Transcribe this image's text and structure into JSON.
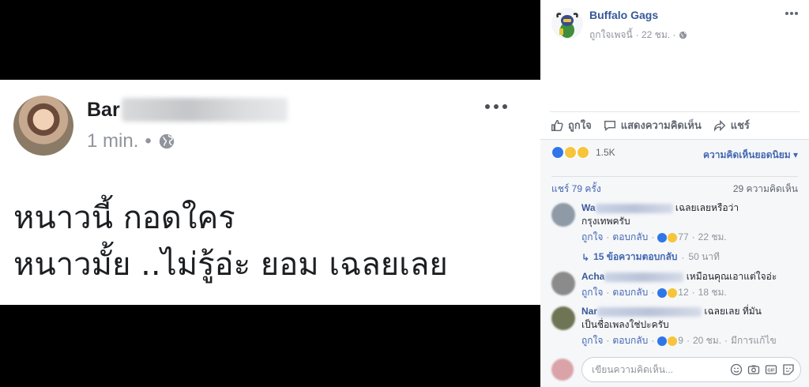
{
  "post_image": {
    "author_name": "Bar",
    "time": "1 min.",
    "bullet": "•",
    "text_line_1": "หนาวนี้ กอดใคร",
    "text_line_2": "หนาวมั้ย ..ไม่รู้อ่ะ ยอม เฉลยเลย"
  },
  "page": {
    "name": "Buffalo Gags",
    "liked_label": "ถูกใจเพจนี้",
    "time": "· 22 ชม. ·"
  },
  "actions": {
    "like": "ถูกใจ",
    "comment": "แสดงความคิดเห็น",
    "share": "แชร์"
  },
  "feedback": {
    "reaction_count": "1.5K",
    "sort_label": "ความคิดเห็นยอดนิยม ▾",
    "shares": "แชร์ 79 ครั้ง",
    "comments_count": "29 ความคิดเห็น"
  },
  "comments": [
    {
      "name": "Wa",
      "text_end": "เฉลยเลยหรือว่า",
      "text_line_2": "กรุงเทพครับ",
      "like": "ถูกใจ",
      "reply": "ตอบกลับ",
      "reacts": "77",
      "time": "22 ชม."
    },
    {
      "name": "Acha",
      "text_end": "เหมือนคุณเอาแต่ใจอ่ะ",
      "text_line_2": "",
      "like": "ถูกใจ",
      "reply": "ตอบกลับ",
      "reacts": "12",
      "time": "18 ชม."
    },
    {
      "name": "Nar",
      "text_end": "เฉลยเลย ที่มัน",
      "text_line_2": "เป็นชื่อเพลงใช่ปะครับ",
      "like": "ถูกใจ",
      "reply": "ตอบกลับ",
      "reacts": "9",
      "time": "20 ชม.",
      "edited": "มีการแก้ไข"
    }
  ],
  "replies": {
    "label": "15 ข้อความตอบกลับ",
    "time": "50 นาที"
  },
  "composer": {
    "placeholder": "เขียนความคิดเห็น..."
  },
  "colors": {
    "fb_blue": "#4267b2",
    "link_blue": "#385898",
    "muted": "#90949c"
  }
}
